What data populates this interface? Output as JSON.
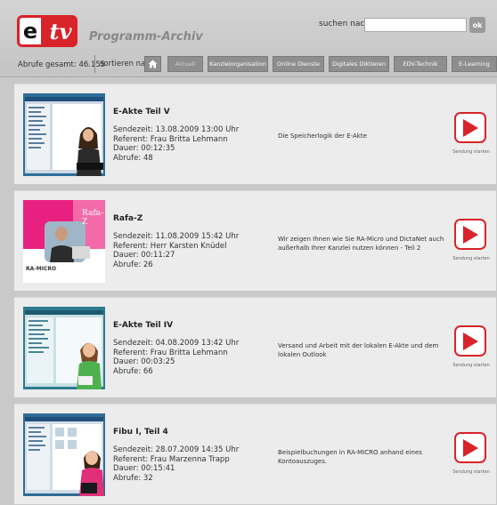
{
  "header": {
    "logo_e": "e",
    "logo_tv": "tv",
    "title": "Programm-Archiv",
    "search_label": "suchen nach:",
    "search_value": "",
    "search_button": "ok",
    "stats": "Abrufe gesamt: 46.155",
    "sort_label": "sortieren nach:",
    "home_icon": "home-icon"
  },
  "tabs": [
    {
      "label": "Aktuell"
    },
    {
      "label": "Kanzleiorganisation"
    },
    {
      "label": "Online Dienste"
    },
    {
      "label": "Digitales Diktieren"
    },
    {
      "label": "EDV-Technik"
    },
    {
      "label": "E-Learning"
    }
  ],
  "videos": [
    {
      "title": "E-Akte Teil V",
      "sendezeit": "Sendezeit: 13.08.2009 13:00 Uhr",
      "referent": "Referent: Frau Britta Lehmann",
      "dauer": "Dauer: 00:12:35",
      "abrufe": "Abrufe: 48",
      "description": "Die Speicherlogik der E-Akte",
      "play_label": "Sendung starten"
    },
    {
      "title": "Rafa-Z",
      "sendezeit": "Sendezeit: 11.08.2009 15:42 Uhr",
      "referent": "Referent: Herr Karsten Knüdel",
      "dauer": "Dauer: 00:11:27",
      "abrufe": "Abrufe: 26",
      "description": "Wir zeigen Ihnen wie Sie RA-Micro und DictaNet auch außerhalb Ihrer Kanzlei nutzen können - Teil 2",
      "play_label": "Sendung starten",
      "thumb_text": "Rafa-Z",
      "thumb_brand": "RA-MICRO"
    },
    {
      "title": "E-Akte Teil IV",
      "sendezeit": "Sendezeit: 04.08.2009 13:42 Uhr",
      "referent": "Referent: Frau Britta Lehmann",
      "dauer": "Dauer: 00:03:25",
      "abrufe": "Abrufe: 66",
      "description": "Versand und Arbeit mit der lokalen E-Akte und dem lokalen Outlook",
      "play_label": "Sendung starten"
    },
    {
      "title": "Fibu I, Teil 4",
      "sendezeit": "Sendezeit: 28.07.2009 14:35 Uhr",
      "referent": "Referent: Frau Marzenna Trapp",
      "dauer": "Dauer: 00:15:41",
      "abrufe": "Abrufe: 32",
      "description": "Beispielbuchungen in RA-MICRO anhand eines Kontoauszuges.",
      "play_label": "Sendung starten"
    }
  ]
}
